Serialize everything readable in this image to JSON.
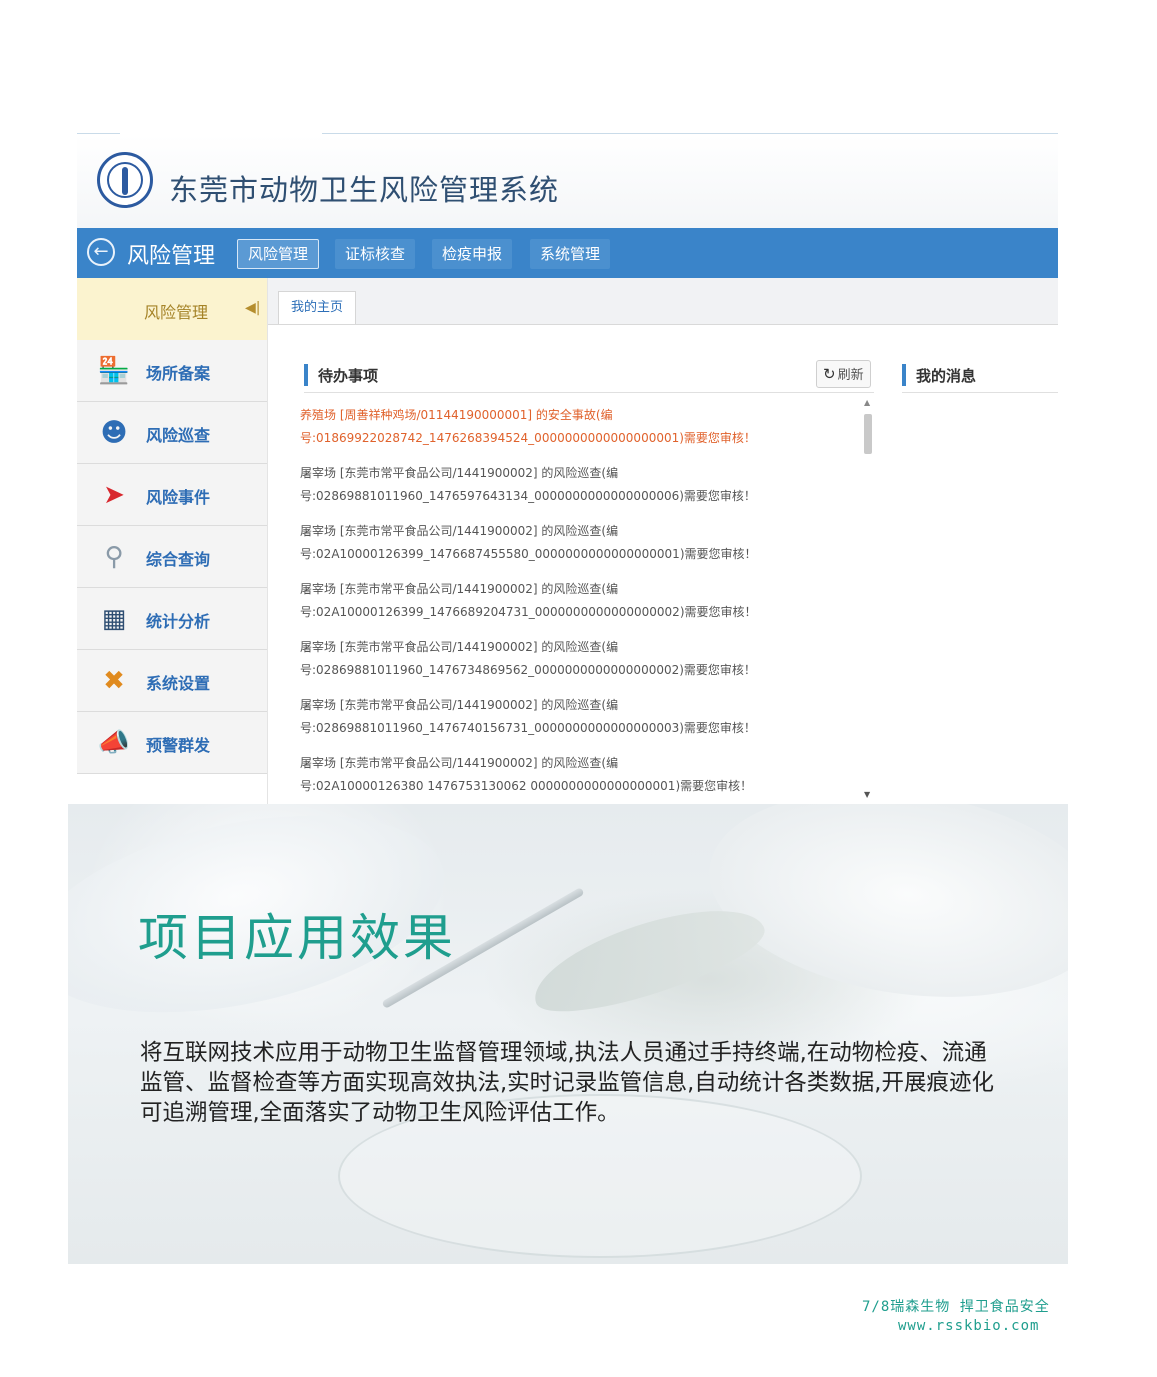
{
  "header": {
    "system_title": "东莞市动物卫生风险管理系统"
  },
  "navbar": {
    "module_title": "风险管理",
    "tabs": [
      {
        "label": "风险管理",
        "active": true
      },
      {
        "label": "证标核查",
        "active": false
      },
      {
        "label": "检疫申报",
        "active": false
      },
      {
        "label": "系统管理",
        "active": false
      }
    ]
  },
  "sidebar": {
    "head_label": "风险管理",
    "items": [
      {
        "label": "场所备案",
        "icon": "store-icon"
      },
      {
        "label": "风险巡查",
        "icon": "inspector-icon"
      },
      {
        "label": "风险事件",
        "icon": "pin-icon"
      },
      {
        "label": "综合查询",
        "icon": "search-icon"
      },
      {
        "label": "统计分析",
        "icon": "chart-icon"
      },
      {
        "label": "系统设置",
        "icon": "tools-icon"
      },
      {
        "label": "预警群发",
        "icon": "megaphone-icon"
      }
    ]
  },
  "content": {
    "page_tab": "我的主页",
    "todo_title": "待办事项",
    "refresh_label": "刷新",
    "messages_title": "我的消息",
    "todo_items": [
      {
        "line1": "养殖场 [周善祥种鸡场/01144190000001] 的安全事故(编",
        "line2": "号:01869922028742_1476268394524_0000000000000000001)需要您审核！",
        "alert": true
      },
      {
        "line1": "屠宰场 [东莞市常平食品公司/1441900002] 的风险巡查(编",
        "line2": "号:02869881011960_1476597643134_0000000000000000006)需要您审核！",
        "alert": false
      },
      {
        "line1": "屠宰场 [东莞市常平食品公司/1441900002] 的风险巡查(编",
        "line2": "号:02A10000126399_1476687455580_0000000000000000001)需要您审核！",
        "alert": false
      },
      {
        "line1": "屠宰场 [东莞市常平食品公司/1441900002] 的风险巡查(编",
        "line2": "号:02A10000126399_1476689204731_0000000000000000002)需要您审核！",
        "alert": false
      },
      {
        "line1": "屠宰场 [东莞市常平食品公司/1441900002] 的风险巡查(编",
        "line2": "号:02869881011960_1476734869562_0000000000000000002)需要您审核！",
        "alert": false
      },
      {
        "line1": "屠宰场 [东莞市常平食品公司/1441900002] 的风险巡查(编",
        "line2": "号:02869881011960_1476740156731_0000000000000000003)需要您审核！",
        "alert": false
      },
      {
        "line1": "屠宰场 [东莞市常平食品公司/1441900002] 的风险巡查(编",
        "line2": "号:02A10000126380 1476753130062 0000000000000000001)需要您审核！",
        "alert": false
      }
    ]
  },
  "section": {
    "title": "项目应用效果",
    "body": "将互联网技术应用于动物卫生监督管理领域,执法人员通过手持终端,在动物检疫、流通监管、监督检查等方面实现高效执法,实时记录监管信息,自动统计各类数据,开展痕迹化可追溯管理,全面落实了动物卫生风险评估工作。"
  },
  "footer": {
    "line1": "7/8瑞森生物 捍卫食品安全",
    "line2": "www.rsskbio.com"
  },
  "colors": {
    "nav_blue": "#3a84c9",
    "title_teal": "#1f9e8e",
    "alert_orange": "#e0622c",
    "sidebar_label_blue": "#2e6db5"
  }
}
